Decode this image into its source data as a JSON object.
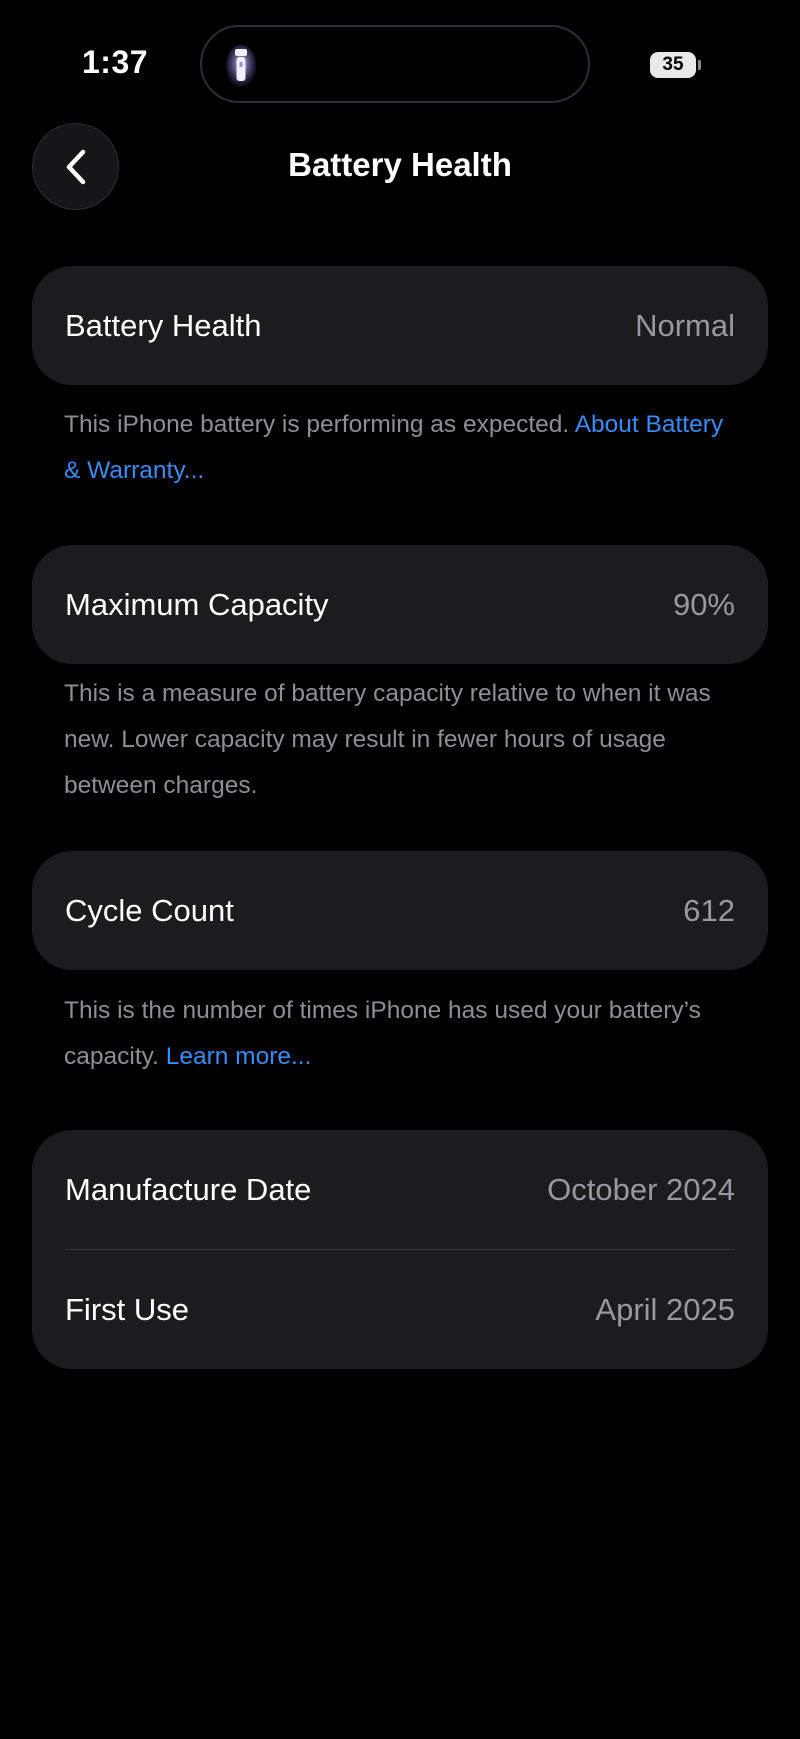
{
  "status_bar": {
    "time": "1:37",
    "battery_level": "35"
  },
  "nav": {
    "title": "Battery Health",
    "back_icon": "chevron-left-icon"
  },
  "battery_health": {
    "label": "Battery Health",
    "value": "Normal",
    "footnote": "This iPhone battery is performing as expected. ",
    "link": "About Battery & Warranty..."
  },
  "maximum_capacity": {
    "label": "Maximum Capacity",
    "value": "90%",
    "footnote": "This is a measure of battery capacity relative to when it was new. Lower capacity may result in fewer hours of usage between charges."
  },
  "cycle_count": {
    "label": "Cycle Count",
    "value": "612",
    "footnote": "This is the number of times iPhone has used your battery’s capacity. ",
    "link": "Learn more..."
  },
  "dates": {
    "manufacture_label": "Manufacture Date",
    "manufacture_value": "October 2024",
    "first_use_label": "First Use",
    "first_use_value": "April 2025"
  },
  "colors": {
    "background": "#000000",
    "card": "#1c1c1e",
    "link": "#3a8bf5",
    "secondary_text": "#98989f"
  }
}
